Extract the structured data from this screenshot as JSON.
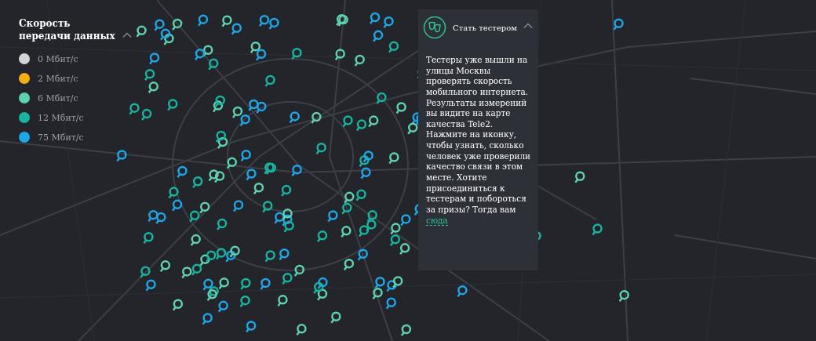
{
  "legend": {
    "title": "Скорость передачи данных",
    "expanded": true,
    "items": [
      {
        "label": "0 Мбит/с",
        "color": "#d4d4d4"
      },
      {
        "label": "2 Мбит/с",
        "color": "#f5ad14"
      },
      {
        "label": "6 Мбит/с",
        "color": "#5fd0b0"
      },
      {
        "label": "12 Мбит/с",
        "color": "#19b3a0"
      },
      {
        "label": "75 Мбит/с",
        "color": "#1ea6e6"
      }
    ]
  },
  "panel": {
    "title": "Стать тестером",
    "expanded": true,
    "text": "Тестеры уже вышли на улицы Москвы проверять скорость мобильного интернета. Результаты измерений вы видите на карте качества Tele2. Нажмите на иконку, чтобы узнать, сколько человек уже проверили качество связи в этом месте. Хотите присоединиться к тестерам и побороться за призы? Тогда вам",
    "link": "сюда"
  }
}
